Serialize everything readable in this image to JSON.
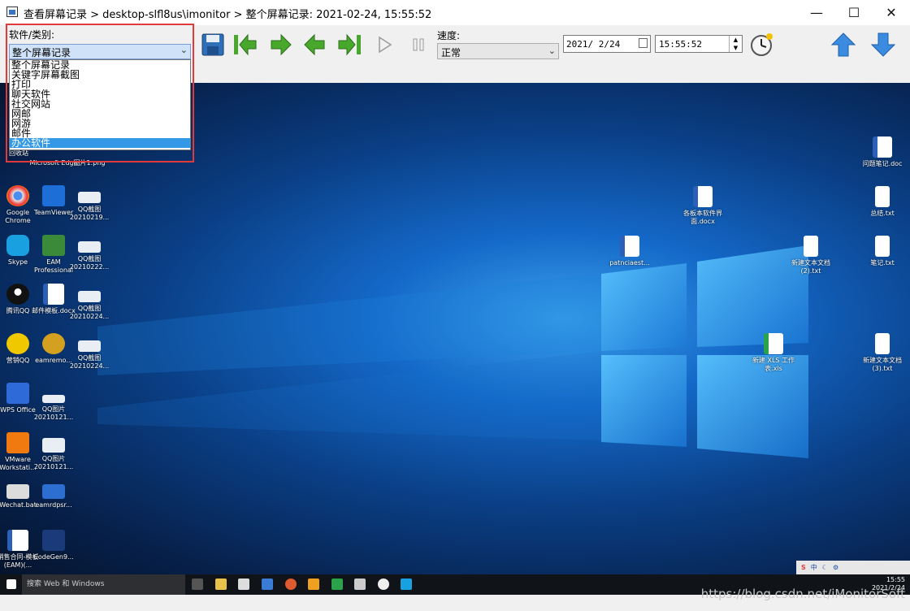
{
  "window": {
    "title": "查看屏幕记录 > desktop-slfl8us\\imonitor > 整个屏幕记录: 2021-02-24, 15:55:52",
    "min": "—",
    "max": "☐",
    "close": "✕"
  },
  "category": {
    "label": "软件/类别:",
    "selected": "整个屏幕记录",
    "options": [
      "整个屏幕记录",
      "关键字屏幕截图",
      "打印",
      "聊天软件",
      "社交网站",
      "网邮",
      "网游",
      "邮件",
      "办公软件"
    ],
    "highlighted": "办公软件"
  },
  "speed": {
    "label": "速度:",
    "selected": "正常"
  },
  "date": {
    "value": "2021/ 2/24"
  },
  "time": {
    "value": "15:55:52"
  },
  "desktop_icons_left": [
    {
      "label": "Google Chrome",
      "color": "#e8e8e8"
    },
    {
      "label": "TeamViewer",
      "color": "#1e6ed8"
    },
    {
      "label": "QQ截图 20210219...",
      "color": "#e8eef3"
    },
    {
      "label": "Skype",
      "color": "#19a0e0"
    },
    {
      "label": "EAM Professional",
      "color": "#3a8a3a"
    },
    {
      "label": "QQ截图 20210222...",
      "color": "#e8eef3"
    },
    {
      "label": "腾讯QQ",
      "color": "#111"
    },
    {
      "label": "邮件模板.docx",
      "color": "#2c5fb8"
    },
    {
      "label": "QQ截图 20210224...",
      "color": "#e8eef3"
    },
    {
      "label": "营销QQ",
      "color": "#f0c800"
    },
    {
      "label": "eamremo...",
      "color": "#d4a020"
    },
    {
      "label": "QQ截图 20210224...",
      "color": "#e8eef3"
    },
    {
      "label": "WPS Office",
      "color": "#2e6ad8"
    },
    {
      "label": "QQ图片 20210121...",
      "color": "#e8eef3"
    },
    {
      "label": "VMware Workstati...",
      "color": "#f07a10"
    },
    {
      "label": "QQ图片 20210121...",
      "color": "#e8eef3"
    },
    {
      "label": "Wechat.bat",
      "color": "#dcdcdc"
    },
    {
      "label": "eamrdpsr...",
      "color": "#2c6fd0"
    },
    {
      "label": "销售合同-模板 (EAM)(...",
      "color": "#2c5fb8"
    },
    {
      "label": "CodeGen9...",
      "color": "#1a3a7a"
    }
  ],
  "desktop_icons_top_partial": [
    {
      "label": "回收站"
    },
    {
      "label": "Microsoft Edge"
    },
    {
      "label": "图片1.png"
    }
  ],
  "desktop_icons_right": [
    {
      "label": "问题笔记.doc"
    },
    {
      "label": "各板本软件界面.docx"
    },
    {
      "label": "总结.txt"
    },
    {
      "label": "patnciaest..."
    },
    {
      "label": "新建文本文档(2).txt"
    },
    {
      "label": "笔记.txt"
    },
    {
      "label": "新建 XLS 工作表.xls"
    },
    {
      "label": "新建文本文档(3).txt"
    }
  ],
  "taskbar": {
    "search": "搜索 Web 和 Windows",
    "time": "15:55",
    "date": "2021/2/24",
    "tray_text": "中"
  },
  "watermark": "https://blog.csdn.net/iMonitorSoft",
  "colors": {
    "accent": "#3399e6",
    "highlight_border": "#e03a3a",
    "nav_green": "#47a82c",
    "nav_blue": "#3b8be0"
  }
}
